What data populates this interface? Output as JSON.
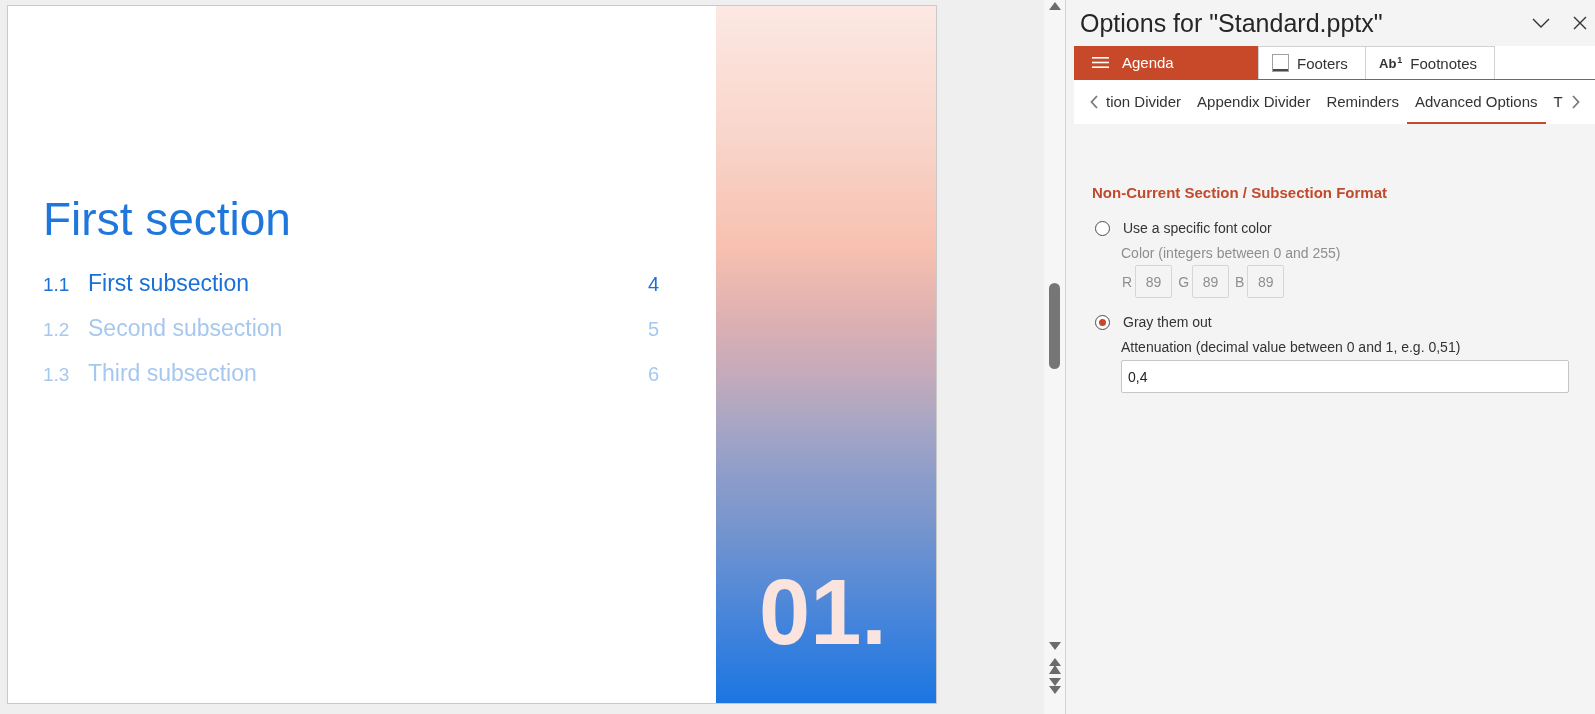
{
  "slide": {
    "section_title": "First section",
    "subsections": [
      {
        "number": "1.1",
        "title": "First subsection",
        "page": "4",
        "selected": true
      },
      {
        "number": "1.2",
        "title": "Second subsection",
        "page": "5",
        "selected": false
      },
      {
        "number": "1.3",
        "title": "Third subsection",
        "page": "6",
        "selected": false
      }
    ],
    "section_number": "01."
  },
  "panel": {
    "title": "Options for \"Standard.pptx\"",
    "tabs": [
      {
        "kind": "menu",
        "label": "Agenda",
        "selected": true
      },
      {
        "kind": "footer",
        "label": "Footers",
        "selected": false
      },
      {
        "kind": "superscript",
        "icon_text": "Ab$^{1}$",
        "label": "Footnotes",
        "selected": false
      }
    ],
    "subtabs": [
      {
        "label": "tion Divider",
        "selected": false
      },
      {
        "label": "Appendix Divider",
        "selected": false
      },
      {
        "label": "Reminders",
        "selected": false
      },
      {
        "label": "Advanced Options",
        "selected": true
      },
      {
        "label": "T",
        "selected": false
      }
    ],
    "section_heading": "Non-Current Section / Subsection Format",
    "options": [
      {
        "kind": "rgb",
        "label": "Use a specific font color",
        "selected": false,
        "disabled": true,
        "hint": "Color (integers between 0 and 255)",
        "channels": [
          {
            "label": "R",
            "value": "89"
          },
          {
            "label": "G",
            "value": "89"
          },
          {
            "label": "B",
            "value": "89"
          }
        ]
      },
      {
        "kind": "number",
        "label": "Gray them out",
        "selected": true,
        "disabled": false,
        "hint": "Attenuation (decimal value between 0 and 1, e.g. 0,51)",
        "value": "0,4"
      }
    ]
  }
}
